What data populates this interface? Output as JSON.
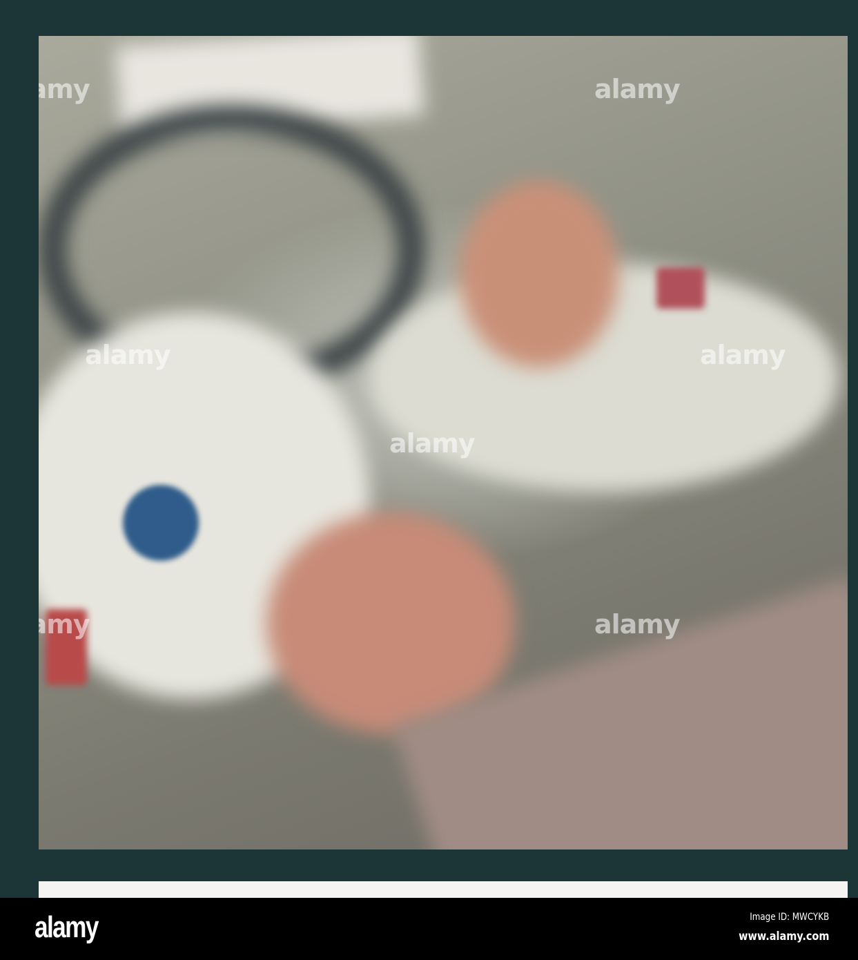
{
  "watermark": "alamy",
  "footer": {
    "logo": "alamy",
    "image_id": "Image ID: MWCYKB",
    "url": "www.alamy.com"
  }
}
